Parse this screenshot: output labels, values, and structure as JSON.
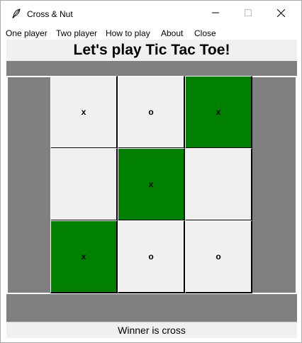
{
  "window": {
    "title": "Cross & Nut",
    "icon": "feather-icon"
  },
  "menu": {
    "items": [
      "One player",
      "Two player",
      "How to play",
      "About",
      "Close"
    ]
  },
  "game": {
    "heading": "Let's play Tic Tac Toe!",
    "board": [
      [
        {
          "mark": "x",
          "win": false
        },
        {
          "mark": "o",
          "win": false
        },
        {
          "mark": "x",
          "win": true
        }
      ],
      [
        {
          "mark": "",
          "win": false
        },
        {
          "mark": "x",
          "win": true
        },
        {
          "mark": "",
          "win": false
        }
      ],
      [
        {
          "mark": "x",
          "win": true
        },
        {
          "mark": "o",
          "win": false
        },
        {
          "mark": "o",
          "win": false
        }
      ]
    ],
    "win_color": "#008000",
    "status": "Winner is cross"
  }
}
